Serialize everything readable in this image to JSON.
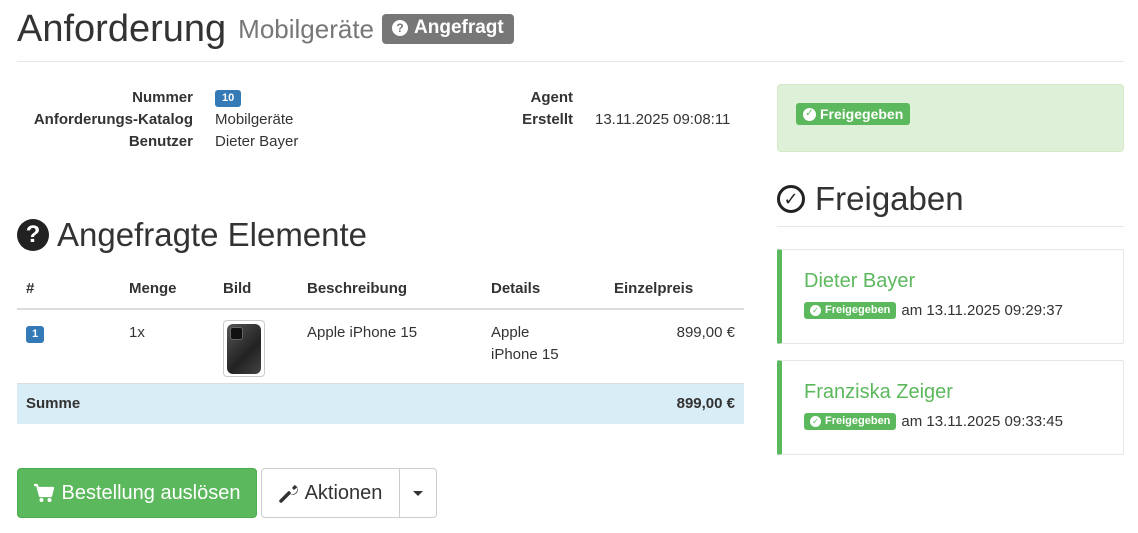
{
  "header": {
    "title": "Anforderung",
    "subtitle": "Mobilgeräte",
    "status": "Angefragt"
  },
  "info_left": [
    {
      "label": "Nummer",
      "value": "10",
      "badge": true
    },
    {
      "label": "Anforderungs-Katalog",
      "value": "Mobilgeräte"
    },
    {
      "label": "Benutzer",
      "value": "Dieter Bayer"
    }
  ],
  "info_right": [
    {
      "label": "Agent",
      "value": ""
    },
    {
      "label": "Erstellt",
      "value": "13.11.2025 09:08:11"
    }
  ],
  "items_section": {
    "title": "Angefragte Elemente"
  },
  "table": {
    "headers": [
      "#",
      "Menge",
      "Bild",
      "Beschreibung",
      "Details",
      "Einzelpreis"
    ],
    "rows": [
      {
        "pos": "1",
        "qty": "1x",
        "description": "Apple iPhone 15",
        "details": "Apple iPhone 15",
        "price": "899,00 €"
      }
    ],
    "sum_label": "Summe",
    "sum_value": "899,00 €"
  },
  "buttons": {
    "order": "Bestellung auslösen",
    "actions": "Aktionen"
  },
  "approval_status": {
    "label": "Freigegeben"
  },
  "approvals_section": {
    "title": "Freigaben"
  },
  "approvals": [
    {
      "name": "Dieter Bayer",
      "status": "Freigegeben",
      "timestamp": "am 13.11.2025 09:29:37"
    },
    {
      "name": "Franziska Zeiger",
      "status": "Freigegeben",
      "timestamp": "am 13.11.2025 09:33:45"
    }
  ],
  "colors": {
    "success": "#5cb85c",
    "primary": "#337ab7",
    "status_gray": "#777777",
    "sum_row": "#d9edf7"
  },
  "icons": {
    "status": "question-circle-icon",
    "items": "question-circle-icon",
    "approvals": "check-circle-icon",
    "order": "cart-icon",
    "actions": "wrench-icon",
    "dropdown": "caret-down-icon"
  }
}
